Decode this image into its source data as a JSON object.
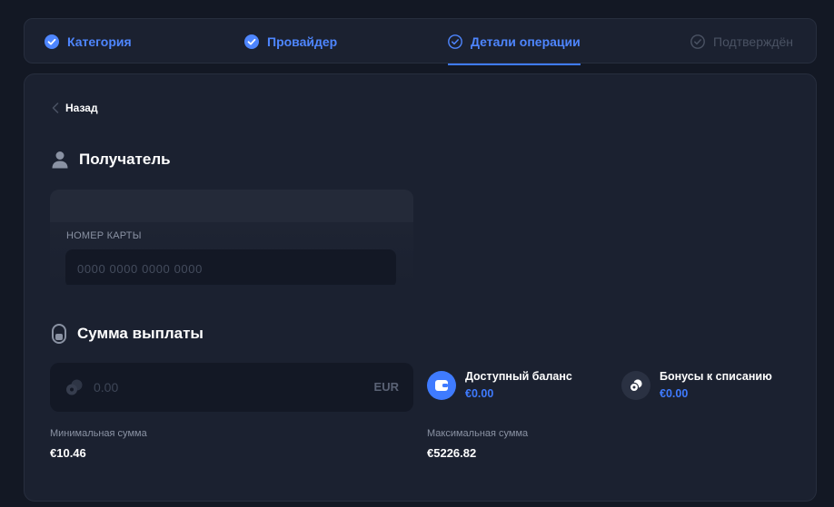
{
  "stepper": {
    "steps": [
      {
        "label": "Категория",
        "state": "done"
      },
      {
        "label": "Провайдер",
        "state": "done"
      },
      {
        "label": "Детали операции",
        "state": "active"
      },
      {
        "label": "Подтверждён",
        "state": "pending"
      }
    ]
  },
  "form": {
    "back_label": "Назад",
    "recipient_title": "Получатель",
    "card_number_label": "НОМЕР КАРТЫ",
    "card_number_placeholder": "0000 0000 0000 0000",
    "payout_title": "Сумма выплаты",
    "amount_placeholder": "0.00",
    "currency": "EUR",
    "available_balance_label": "Доступный баланс",
    "available_balance_value": "€0.00",
    "bonuses_label": "Бонусы к списанию",
    "bonuses_value": "€0.00",
    "min_label": "Минимальная сумма",
    "min_value": "€10.46",
    "max_label": "Максимальная сумма",
    "max_value": "€5226.82"
  },
  "colors": {
    "background": "#131824",
    "panel": "#1b2130",
    "accent": "#3f7bff",
    "muted": "#8a92a3"
  }
}
